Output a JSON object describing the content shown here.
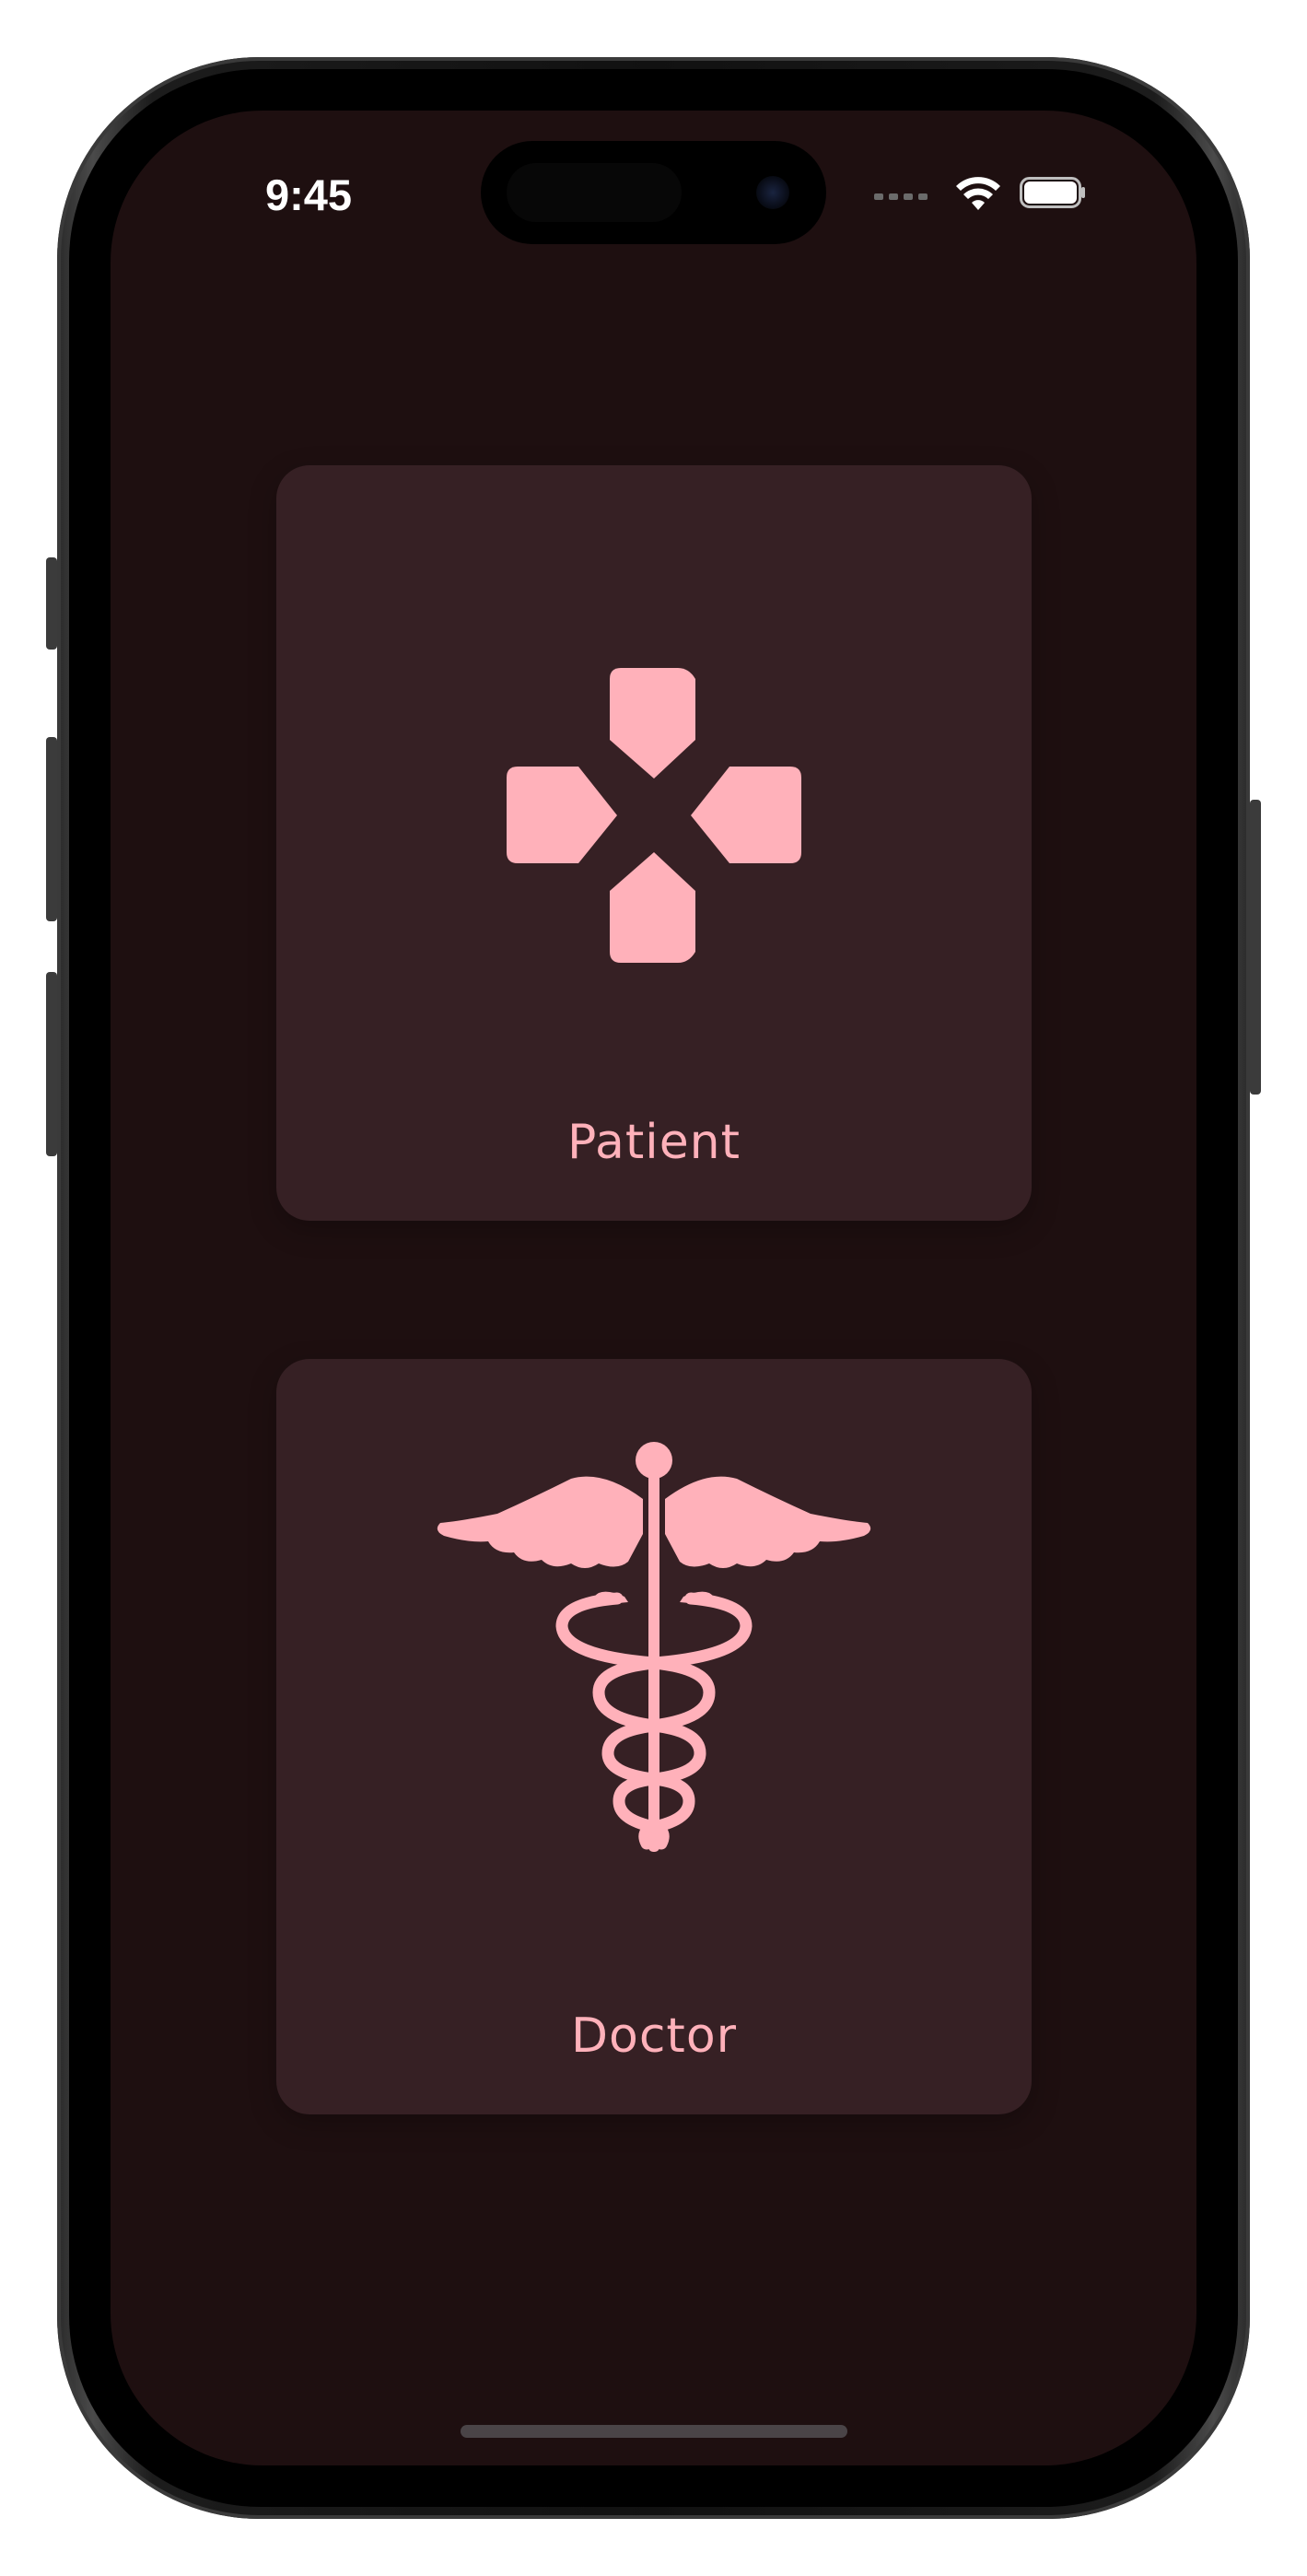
{
  "status_bar": {
    "time": "9:45",
    "signal_icon": "cellular-dots-icon",
    "wifi_icon": "wifi-icon",
    "battery_icon": "battery-icon"
  },
  "cards": [
    {
      "label": "Patient",
      "icon": "medical-cross-icon"
    },
    {
      "label": "Doctor",
      "icon": "caduceus-icon"
    }
  ],
  "colors": {
    "background": "#1e0f10",
    "card": "#362024",
    "accent": "#ffb1ba",
    "status_text": "#ffffff"
  }
}
